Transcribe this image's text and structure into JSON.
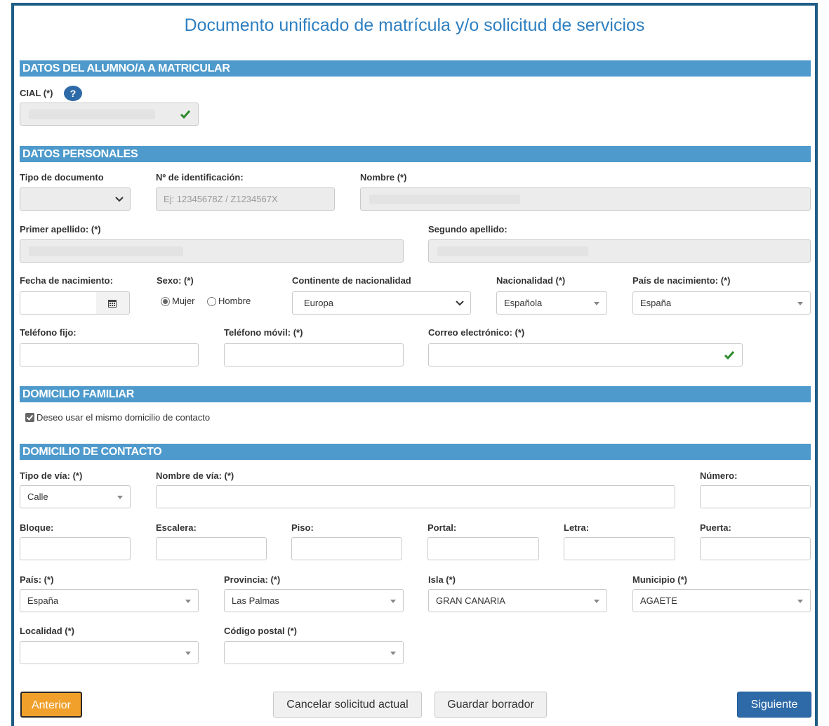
{
  "page": {
    "title": "Documento unificado de matrícula y/o solicitud de servicios"
  },
  "colors": {
    "accent": "#4e9acc",
    "frame": "#1f5d86",
    "primary_button": "#2e6aa8",
    "warn_button": "#f0a02b",
    "valid_check": "#2c8a2c"
  },
  "sections": {
    "alumno": "DATOS DEL ALUMNO/A A MATRICULAR",
    "personales": "DATOS PERSONALES",
    "familiar": "DOMICILIO FAMILIAR",
    "contacto": "DOMICILIO DE CONTACTO"
  },
  "alumno": {
    "cial_label": "CIAL (*)",
    "help_icon": "?"
  },
  "personales": {
    "tipo_documento_label": "Tipo de documento",
    "identificacion_label": "Nº de identificación:",
    "identificacion_placeholder": "Ej: 12345678Z / Z1234567X",
    "nombre_label": "Nombre (*)",
    "primer_apellido_label": "Primer apellido: (*)",
    "segundo_apellido_label": "Segundo apellido:",
    "fecha_nacimiento_label": "Fecha de nacimiento:",
    "sexo_label": "Sexo: (*)",
    "sexo_mujer": "Mujer",
    "sexo_hombre": "Hombre",
    "continente_label": "Continente de nacionalidad",
    "continente_value": "Europa",
    "nacionalidad_label": "Nacionalidad (*)",
    "nacionalidad_value": "Española",
    "pais_nacimiento_label": "País de nacimiento: (*)",
    "pais_nacimiento_value": "España",
    "telefono_fijo_label": "Teléfono fijo:",
    "telefono_movil_label": "Teléfono móvil: (*)",
    "correo_label": "Correo electrónico: (*)"
  },
  "familiar": {
    "mismo_domicilio_label": "Deseo usar el mismo domicilio de contacto"
  },
  "contacto": {
    "tipo_via_label": "Tipo de vía: (*)",
    "tipo_via_value": "Calle",
    "nombre_via_label": "Nombre de vía: (*)",
    "numero_label": "Número:",
    "bloque_label": "Bloque:",
    "escalera_label": "Escalera:",
    "piso_label": "Piso:",
    "portal_label": "Portal:",
    "letra_label": "Letra:",
    "puerta_label": "Puerta:",
    "pais_label": "País: (*)",
    "pais_value": "España",
    "provincia_label": "Provincia: (*)",
    "provincia_value": "Las Palmas",
    "isla_label": "Isla (*)",
    "isla_value": "GRAN CANARIA",
    "municipio_label": "Municipio (*)",
    "municipio_value": "AGAETE",
    "localidad_label": "Localidad (*)",
    "codigo_postal_label": "Código postal (*)"
  },
  "buttons": {
    "anterior": "Anterior",
    "cancelar": "Cancelar solicitud actual",
    "guardar": "Guardar borrador",
    "siguiente": "Siguiente"
  }
}
